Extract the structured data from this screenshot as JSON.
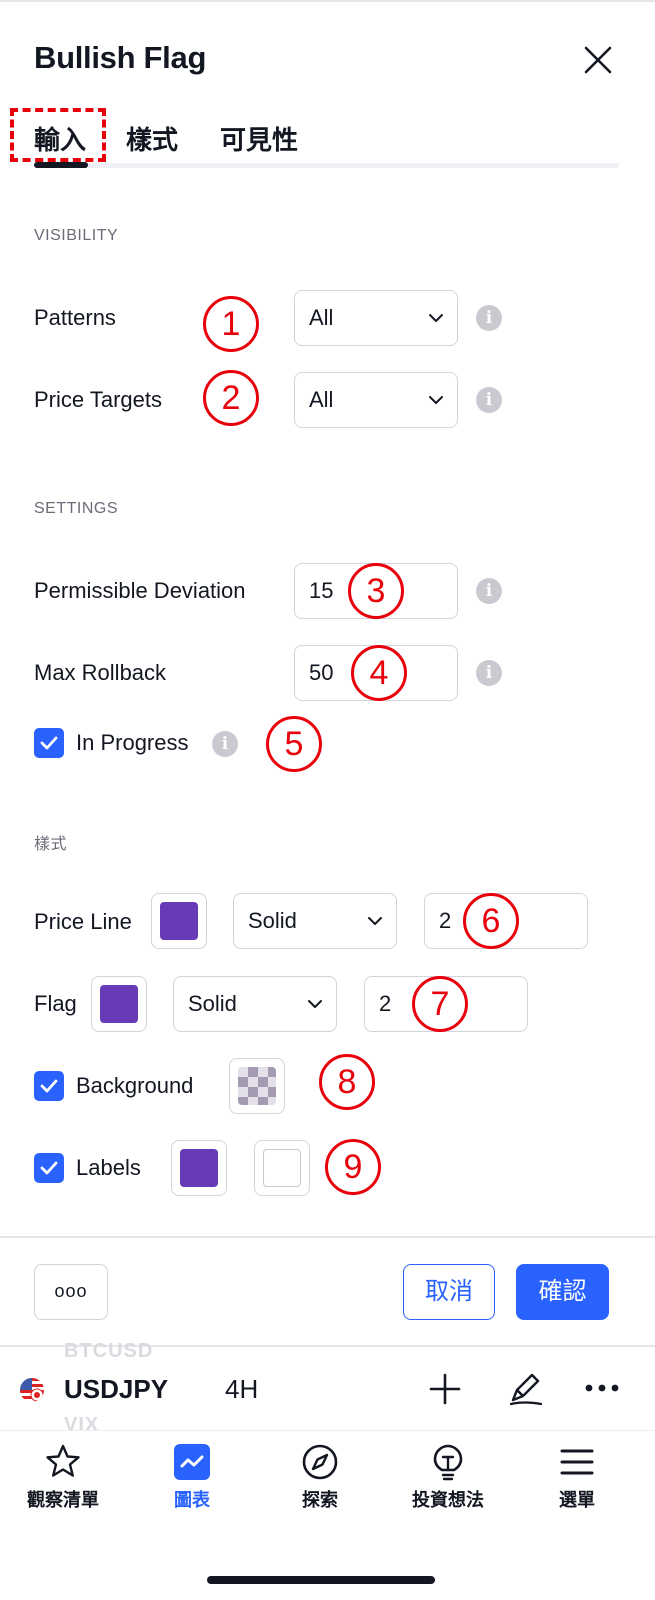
{
  "dialog": {
    "title": "Bullish Flag",
    "tabs": [
      "輸入",
      "樣式",
      "可見性"
    ],
    "active_tab": "輸入"
  },
  "visibility": {
    "section_label": "VISIBILITY",
    "patterns": {
      "label": "Patterns",
      "value": "All",
      "badge": "1"
    },
    "price_targets": {
      "label": "Price Targets",
      "value": "All",
      "badge": "2"
    }
  },
  "settings": {
    "section_label": "SETTINGS",
    "permissible_deviation": {
      "label": "Permissible Deviation",
      "value": "15",
      "badge": "3"
    },
    "max_rollback": {
      "label": "Max Rollback",
      "value": "50",
      "badge": "4"
    },
    "in_progress": {
      "label": "In Progress",
      "checked": true,
      "badge": "5"
    }
  },
  "style": {
    "section_label": "樣式",
    "price_line": {
      "label": "Price Line",
      "color": "#673ab7",
      "line_style": "Solid",
      "width": "2",
      "badge": "6"
    },
    "flag": {
      "label": "Flag",
      "color": "#673ab7",
      "line_style": "Solid",
      "width": "2",
      "badge": "7"
    },
    "background": {
      "label": "Background",
      "checked": true,
      "badge": "8"
    },
    "labels": {
      "label": "Labels",
      "checked": true,
      "color": "#673ab7",
      "text_color": "#ffffff",
      "badge": "9"
    }
  },
  "footer": {
    "more_label": "ooo",
    "cancel_label": "取消",
    "confirm_label": "確認"
  },
  "chart_bar": {
    "prev_symbol": "BTCUSD",
    "symbol": "USDJPY",
    "interval": "4H",
    "next_symbol": "VIX"
  },
  "bottom_nav": {
    "items": [
      {
        "label": "觀察清單",
        "icon": "star-icon",
        "active": false
      },
      {
        "label": "圖表",
        "icon": "chart-icon",
        "active": true
      },
      {
        "label": "探索",
        "icon": "compass-icon",
        "active": false
      },
      {
        "label": "投資想法",
        "icon": "lightbulb-icon",
        "active": false
      },
      {
        "label": "選單",
        "icon": "menu-icon",
        "active": false
      }
    ]
  },
  "colors": {
    "accent": "#2962ff",
    "annotation": "#e8000b",
    "swatch_purple": "#673ab7"
  }
}
